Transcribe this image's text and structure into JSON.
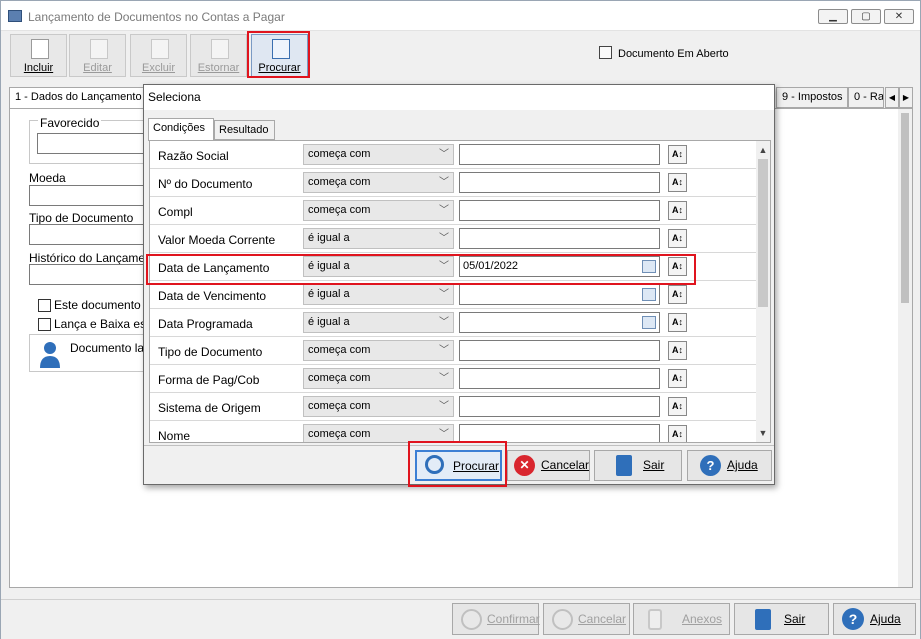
{
  "window": {
    "title": "Lançamento de Documentos no Contas a Pagar",
    "min": "▁",
    "max": "▢",
    "close": "✕"
  },
  "toolbar": {
    "incluir": "Incluir",
    "editar": "Editar",
    "excluir": "Excluir",
    "estornar": "Estornar",
    "procurar": "Procurar"
  },
  "status": {
    "doc": "Documento Em Aberto"
  },
  "main_tabs": {
    "dados": "1 - Dados do Lançamento",
    "impostos": "9 - Impostos",
    "rateio": "0 - Ra"
  },
  "form": {
    "favorecido": "Favorecido",
    "moeda": "Moeda",
    "tipo_documento": "Tipo de Documento",
    "historico": "Histórico do Lançamento",
    "chk1": "Este documento s",
    "chk2": "Lança e Baixa este",
    "doc_lanc": "Documento lan"
  },
  "dialog": {
    "title": "Seleciona",
    "tabs": {
      "condicoes": "Condições",
      "resultado": "Resultado"
    },
    "rows": [
      {
        "label": "Razão Social",
        "op": "começa com",
        "value": ""
      },
      {
        "label": "Nº do Documento",
        "op": "começa com",
        "value": ""
      },
      {
        "label": "Compl",
        "op": "começa com",
        "value": ""
      },
      {
        "label": "Valor Moeda Corrente",
        "op": "é igual a",
        "value": ""
      },
      {
        "label": "Data de Lançamento",
        "op": "é igual a",
        "value": "05/01/2022"
      },
      {
        "label": "Data de Vencimento",
        "op": "é igual a",
        "value": ""
      },
      {
        "label": "Data Programada",
        "op": "é igual a",
        "value": ""
      },
      {
        "label": "Tipo de Documento",
        "op": "começa com",
        "value": ""
      },
      {
        "label": "Forma de Pag/Cob",
        "op": "começa com",
        "value": ""
      },
      {
        "label": "Sistema de Origem",
        "op": "começa com",
        "value": ""
      },
      {
        "label": "Nome",
        "op": "começa com",
        "value": ""
      }
    ],
    "buttons": {
      "procurar": "Procurar",
      "cancelar": "Cancelar",
      "sair": "Sair",
      "ajuda": "Ajuda"
    }
  },
  "bottom": {
    "confirmar": "Confirmar",
    "cancelar": "Cancelar",
    "anexos": "Anexos",
    "sair": "Sair",
    "ajuda": "Ajuda"
  },
  "colors": {
    "highlight": "#e0141e",
    "accent": "#3c7fd4"
  }
}
